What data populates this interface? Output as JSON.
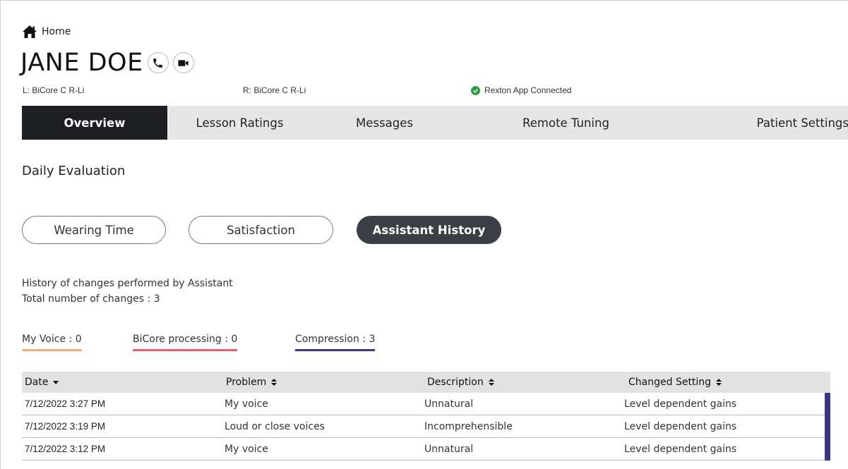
{
  "breadcrumb": {
    "icon": "home-icon",
    "label": "Home"
  },
  "patient": {
    "name": "JANE DOE",
    "call_icon": "phone-icon",
    "video_icon": "video-camera-icon"
  },
  "devices": {
    "left": "L: BiCore C R-Li",
    "right": "R: BiCore C R-Li",
    "connection": "Rexton App Connected",
    "connection_color": "#2e9a4a"
  },
  "tabs": [
    {
      "label": "Overview",
      "active": true
    },
    {
      "label": "Lesson Ratings",
      "active": false
    },
    {
      "label": "Messages",
      "active": false
    },
    {
      "label": "Remote Tuning",
      "active": false
    },
    {
      "label": "Patient Settings",
      "active": false
    }
  ],
  "section_title": "Daily Evaluation",
  "pills": [
    {
      "label": "Wearing Time",
      "active": false
    },
    {
      "label": "Satisfaction",
      "active": false
    },
    {
      "label": "Assistant History",
      "active": true
    }
  ],
  "summary": {
    "description": "History of changes performed by Assistant",
    "total": "Total number of changes : 3"
  },
  "legend": [
    {
      "label": "My Voice : 0",
      "color": "#e8b27a"
    },
    {
      "label": "BiCore processing : 0",
      "color": "#d9636b"
    },
    {
      "label": "Compression : 3",
      "color": "#3b3680"
    }
  ],
  "table": {
    "columns": [
      {
        "label": "Date",
        "sort_icon": "caret-down-icon"
      },
      {
        "label": "Problem",
        "sort_icon": "sort-icon"
      },
      {
        "label": "Description",
        "sort_icon": "sort-icon"
      },
      {
        "label": "Changed Setting",
        "sort_icon": "sort-icon"
      }
    ],
    "rows": [
      {
        "date": "7/12/2022 3:27 PM",
        "problem": "My voice",
        "description": "Unnatural",
        "setting": "Level dependent gains"
      },
      {
        "date": "7/12/2022 3:19 PM",
        "problem": "Loud or close voices",
        "description": "Incomprehensible",
        "setting": "Level dependent gains"
      },
      {
        "date": "7/12/2022 3:12 PM",
        "problem": "My voice",
        "description": "Unnatural",
        "setting": "Level dependent gains"
      }
    ]
  }
}
